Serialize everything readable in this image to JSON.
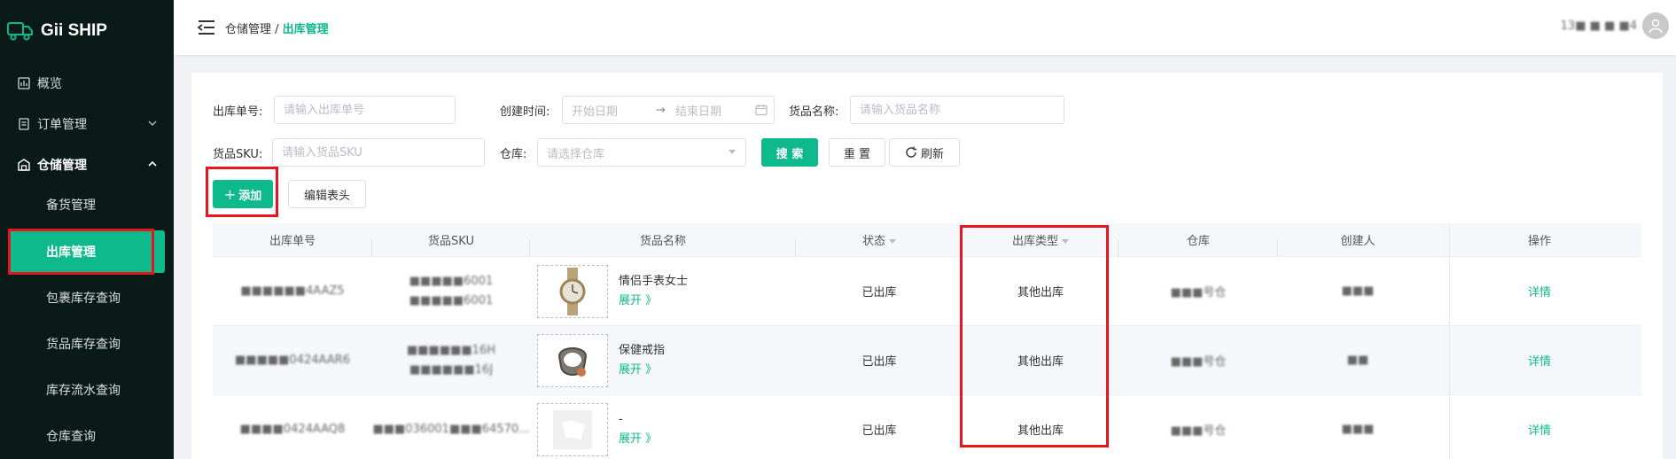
{
  "app": {
    "name": "Gii SHIP"
  },
  "sidebar": {
    "items": [
      {
        "label": "概览",
        "icon": "dashboard-icon"
      },
      {
        "label": "订单管理",
        "icon": "order-icon"
      },
      {
        "label": "仓储管理",
        "icon": "warehouse-icon"
      }
    ],
    "sub_items": [
      {
        "label": "备货管理"
      },
      {
        "label": "出库管理"
      },
      {
        "label": "包裹库存查询"
      },
      {
        "label": "货品库存查询"
      },
      {
        "label": "库存流水查询"
      },
      {
        "label": "仓库查询"
      }
    ]
  },
  "header": {
    "breadcrumb_parent": "仓储管理",
    "breadcrumb_sep": " / ",
    "breadcrumb_current": "出库管理",
    "user_number": "13■ ■ ■ ■4"
  },
  "filters": {
    "out_no_label": "出库单号:",
    "out_no_placeholder": "请输入出库单号",
    "created_label": "创建时间:",
    "start_placeholder": "开始日期",
    "range_sep": "→",
    "end_placeholder": "结束日期",
    "goods_name_label": "货品名称:",
    "goods_name_placeholder": "请输入货品名称",
    "sku_label": "货品SKU:",
    "sku_placeholder": "请输入货品SKU",
    "warehouse_label": "仓库:",
    "warehouse_placeholder": "请选择仓库",
    "search_btn": "搜 索",
    "reset_btn": "重 置",
    "refresh_btn": "刷新"
  },
  "actions": {
    "add_btn": "添加",
    "edit_header_btn": "编辑表头"
  },
  "table": {
    "columns": [
      "出库单号",
      "货品SKU",
      "货品名称",
      "状态",
      "出库类型",
      "仓库",
      "创建人",
      "操作"
    ],
    "rows": [
      {
        "order_no": "■■■■■■4AAZ5",
        "sku1": "■■■■■6001",
        "sku2": "■■■■■6001",
        "goods_name": "情侣手表女士",
        "expand": "展开 》",
        "status": "已出库",
        "out_type": "其他出库",
        "warehouse": "■■■号仓",
        "creator": "■■■",
        "op": "详情"
      },
      {
        "order_no": "■■■■■0424AAR6",
        "sku1": "■■■■■■16H",
        "sku2": "■■■■■■16J",
        "goods_name": "保健戒指",
        "expand": "展开 》",
        "status": "已出库",
        "out_type": "其他出库",
        "warehouse": "■■■号仓",
        "creator": "■■",
        "op": "详情"
      },
      {
        "order_no": "■■■■0424AAQ8",
        "sku1": "■■■036001",
        "sku2": "■■■64570...",
        "goods_name": "-",
        "expand": "展开 》",
        "status": "已出库",
        "out_type": "其他出库",
        "warehouse": "■■■号仓",
        "creator": "■■■",
        "op": "详情"
      }
    ]
  },
  "colors": {
    "accent": "#0eb98b",
    "sidebar_bg": "#0a1a17",
    "highlight": "#e5161d"
  }
}
